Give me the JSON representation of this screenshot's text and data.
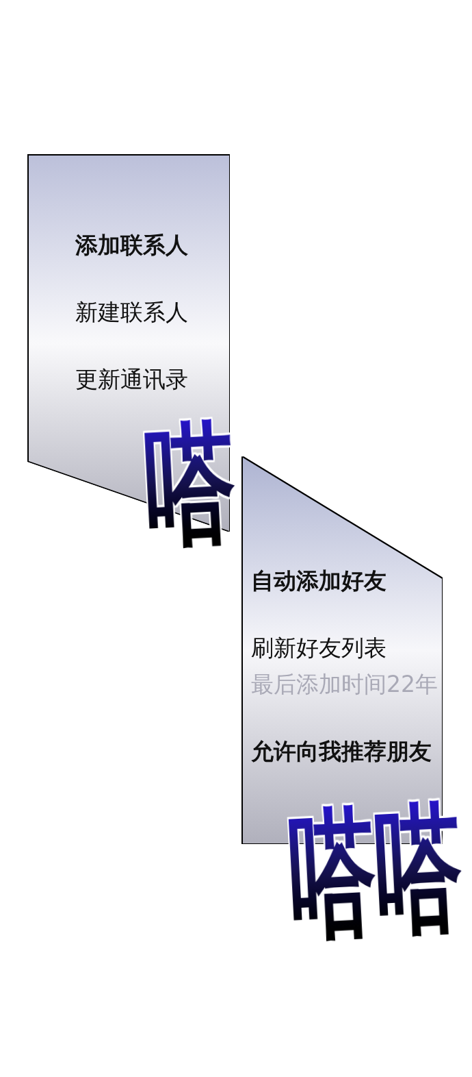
{
  "panels": [
    {
      "items": [
        {
          "kind": "header",
          "text": "添加联系人"
        },
        {
          "kind": "item",
          "text": "新建联系人"
        },
        {
          "kind": "item",
          "text": "更新通讯录"
        }
      ],
      "sound_effect": "嗒"
    },
    {
      "items": [
        {
          "kind": "header",
          "text": "自动添加好友"
        },
        {
          "kind": "item",
          "text": "刷新好友列表"
        },
        {
          "kind": "note",
          "text": "最后添加时间22年"
        },
        {
          "kind": "header",
          "text": "允许向我推荐朋友"
        }
      ],
      "sound_effect": "嗒嗒"
    }
  ]
}
